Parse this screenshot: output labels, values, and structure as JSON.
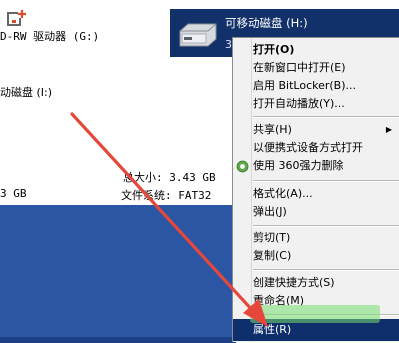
{
  "drives": {
    "dvd": {
      "label": "D-RW 驱动器 (G:)"
    },
    "removable_left": {
      "label": "动磁盘 (I:)"
    },
    "selected": {
      "name": "可移动磁盘 (H:)",
      "sub": "3"
    }
  },
  "details": {
    "total_size": "总大小: 3.43 GB",
    "file_system_label": "文件系统: FAT32",
    "size_short": "3 GB"
  },
  "context_menu": {
    "items": [
      {
        "label": "打开(O)",
        "bold": true
      },
      {
        "label": "在新窗口中打开(E)"
      },
      {
        "label": "启用 BitLocker(B)..."
      },
      {
        "label": "打开自动播放(Y)..."
      },
      {
        "label": "共享(H)"
      },
      {
        "label": "以便携式设备方式打开"
      },
      {
        "label": "使用 360强力删除"
      },
      {
        "label": "格式化(A)..."
      },
      {
        "label": "弹出(J)"
      },
      {
        "label": "剪切(T)"
      },
      {
        "label": "复制(C)"
      },
      {
        "label": "创建快捷方式(S)"
      },
      {
        "label": "重命名(M)"
      },
      {
        "label": "属性(R)"
      }
    ],
    "submenu_arrow": "▶"
  },
  "colors": {
    "selection_blue": "#12306a",
    "desktop_blue": "#2b56a3",
    "arrow_red": "#e5483b",
    "menu_bg": "#f1f1f1"
  },
  "icons": {
    "corner": "app-corner-icon",
    "drive": "removable-drive-icon",
    "delete": "360-delete-icon"
  }
}
